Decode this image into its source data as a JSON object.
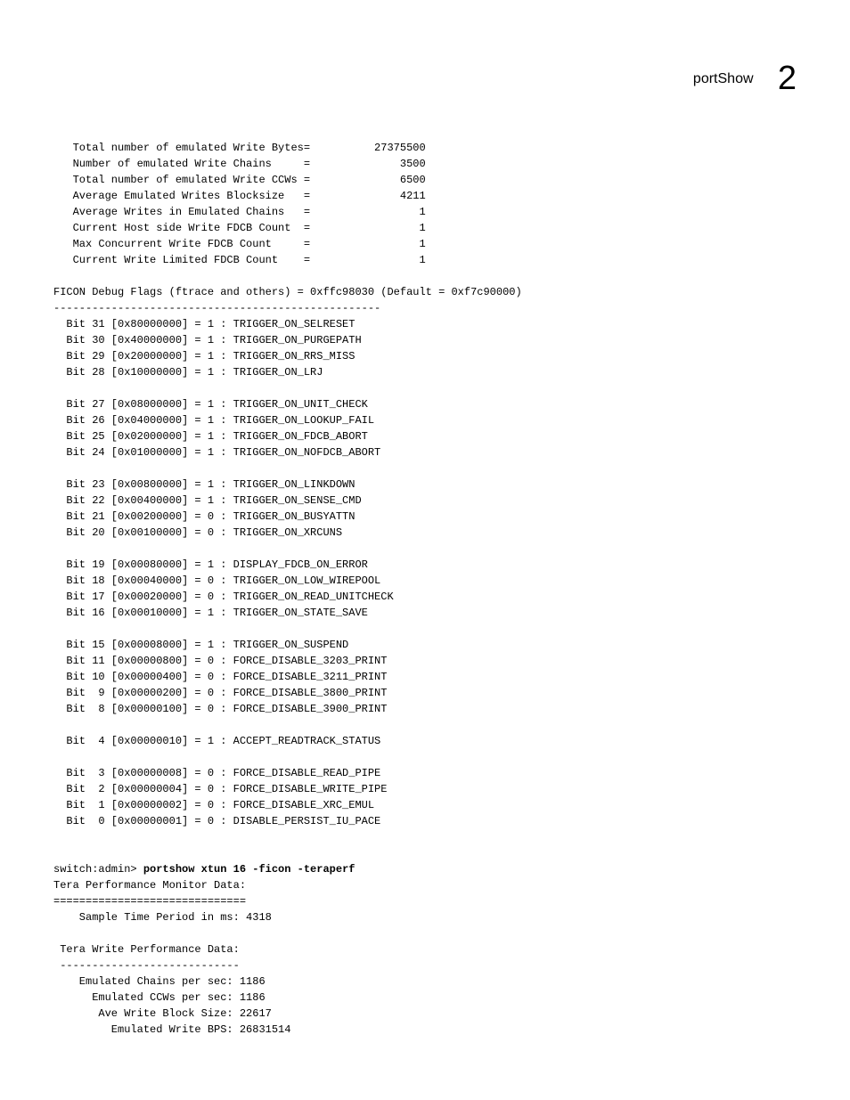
{
  "header": {
    "title": "portShow",
    "page": "2"
  },
  "stats": [
    "   Total number of emulated Write Bytes=          27375500",
    "   Number of emulated Write Chains     =              3500",
    "   Total number of emulated Write CCWs =              6500",
    "   Average Emulated Writes Blocksize   =              4211",
    "   Average Writes in Emulated Chains   =                 1",
    "   Current Host side Write FDCB Count  =                 1",
    "   Max Concurrent Write FDCB Count     =                 1",
    "   Current Write Limited FDCB Count    =                 1"
  ],
  "ficon_header": "FICON Debug Flags (ftrace and others) = 0xffc98030 (Default = 0xf7c90000)",
  "ficon_divider": "---------------------------------------------------",
  "bits": [
    "  Bit 31 [0x80000000] = 1 : TRIGGER_ON_SELRESET",
    "  Bit 30 [0x40000000] = 1 : TRIGGER_ON_PURGEPATH",
    "  Bit 29 [0x20000000] = 1 : TRIGGER_ON_RRS_MISS",
    "  Bit 28 [0x10000000] = 1 : TRIGGER_ON_LRJ",
    "",
    "  Bit 27 [0x08000000] = 1 : TRIGGER_ON_UNIT_CHECK",
    "  Bit 26 [0x04000000] = 1 : TRIGGER_ON_LOOKUP_FAIL",
    "  Bit 25 [0x02000000] = 1 : TRIGGER_ON_FDCB_ABORT",
    "  Bit 24 [0x01000000] = 1 : TRIGGER_ON_NOFDCB_ABORT",
    "",
    "  Bit 23 [0x00800000] = 1 : TRIGGER_ON_LINKDOWN",
    "  Bit 22 [0x00400000] = 1 : TRIGGER_ON_SENSE_CMD",
    "  Bit 21 [0x00200000] = 0 : TRIGGER_ON_BUSYATTN",
    "  Bit 20 [0x00100000] = 0 : TRIGGER_ON_XRCUNS",
    "",
    "  Bit 19 [0x00080000] = 1 : DISPLAY_FDCB_ON_ERROR",
    "  Bit 18 [0x00040000] = 0 : TRIGGER_ON_LOW_WIREPOOL",
    "  Bit 17 [0x00020000] = 0 : TRIGGER_ON_READ_UNITCHECK",
    "  Bit 16 [0x00010000] = 1 : TRIGGER_ON_STATE_SAVE",
    "",
    "  Bit 15 [0x00008000] = 1 : TRIGGER_ON_SUSPEND",
    "  Bit 11 [0x00000800] = 0 : FORCE_DISABLE_3203_PRINT",
    "  Bit 10 [0x00000400] = 0 : FORCE_DISABLE_3211_PRINT",
    "  Bit  9 [0x00000200] = 0 : FORCE_DISABLE_3800_PRINT",
    "  Bit  8 [0x00000100] = 0 : FORCE_DISABLE_3900_PRINT",
    "",
    "  Bit  4 [0x00000010] = 1 : ACCEPT_READTRACK_STATUS",
    "",
    "  Bit  3 [0x00000008] = 0 : FORCE_DISABLE_READ_PIPE",
    "  Bit  2 [0x00000004] = 0 : FORCE_DISABLE_WRITE_PIPE",
    "  Bit  1 [0x00000002] = 0 : FORCE_DISABLE_XRC_EMUL",
    "  Bit  0 [0x00000001] = 0 : DISABLE_PERSIST_IU_PACE"
  ],
  "prompt": "switch:admin> ",
  "command": "portshow xtun 16 -ficon -teraperf",
  "tera": [
    "Tera Performance Monitor Data:",
    "==============================",
    "    Sample Time Period in ms: 4318",
    "",
    " Tera Write Performance Data:",
    " ----------------------------",
    "    Emulated Chains per sec: 1186",
    "      Emulated CCWs per sec: 1186",
    "       Ave Write Block Size: 22617",
    "         Emulated Write BPS: 26831514"
  ]
}
